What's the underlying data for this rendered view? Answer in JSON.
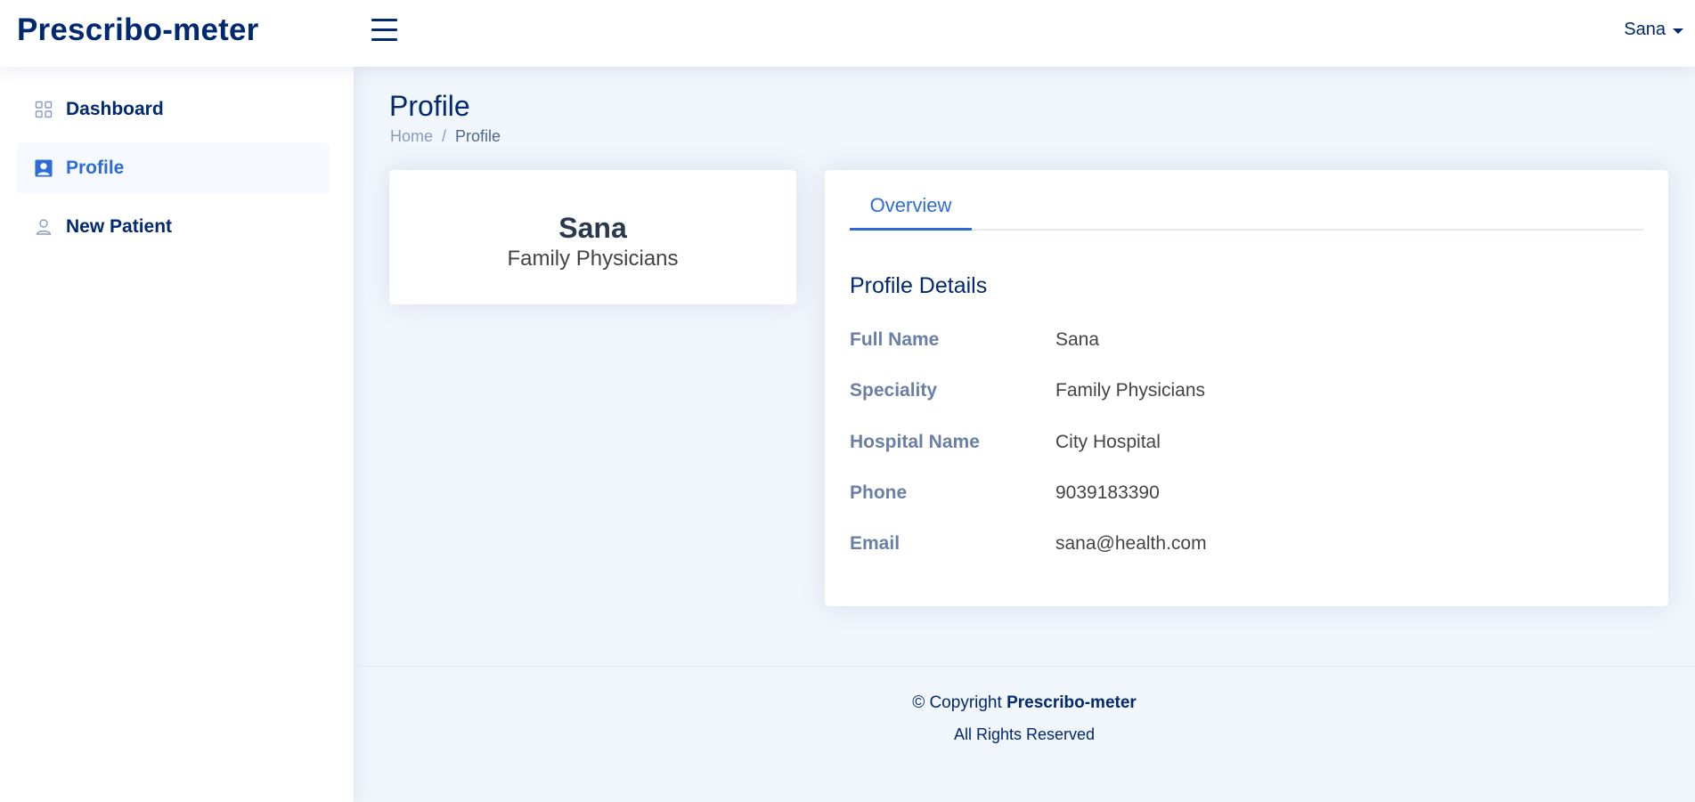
{
  "header": {
    "logo": "Prescribo-meter",
    "user_name": "Sana",
    "menu_toggle_icon": "hamburger-icon"
  },
  "sidebar": {
    "items": [
      {
        "label": "Dashboard",
        "icon": "grid-icon",
        "active": false
      },
      {
        "label": "Profile",
        "icon": "person-square-icon",
        "active": true
      },
      {
        "label": "New Patient",
        "icon": "person-icon",
        "active": false
      }
    ]
  },
  "page": {
    "title": "Profile",
    "breadcrumb": {
      "home": "Home",
      "separator": "/",
      "current": "Profile"
    }
  },
  "profile_card": {
    "name": "Sana",
    "speciality": "Family Physicians"
  },
  "details": {
    "tab": "Overview",
    "section_title": "Profile Details",
    "rows": [
      {
        "label": "Full Name",
        "value": "Sana"
      },
      {
        "label": "Speciality",
        "value": "Family Physicians"
      },
      {
        "label": "Hospital Name",
        "value": "City Hospital"
      },
      {
        "label": "Phone",
        "value": "9039183390"
      },
      {
        "label": "Email",
        "value": "sana@health.com"
      }
    ]
  },
  "footer": {
    "copyright_prefix": "© Copyright",
    "brand": "Prescribo-meter",
    "rights": "All Rights Reserved"
  },
  "colors": {
    "primary": "#012970",
    "accent": "#2e6bd6",
    "background": "#f1f5fc"
  }
}
